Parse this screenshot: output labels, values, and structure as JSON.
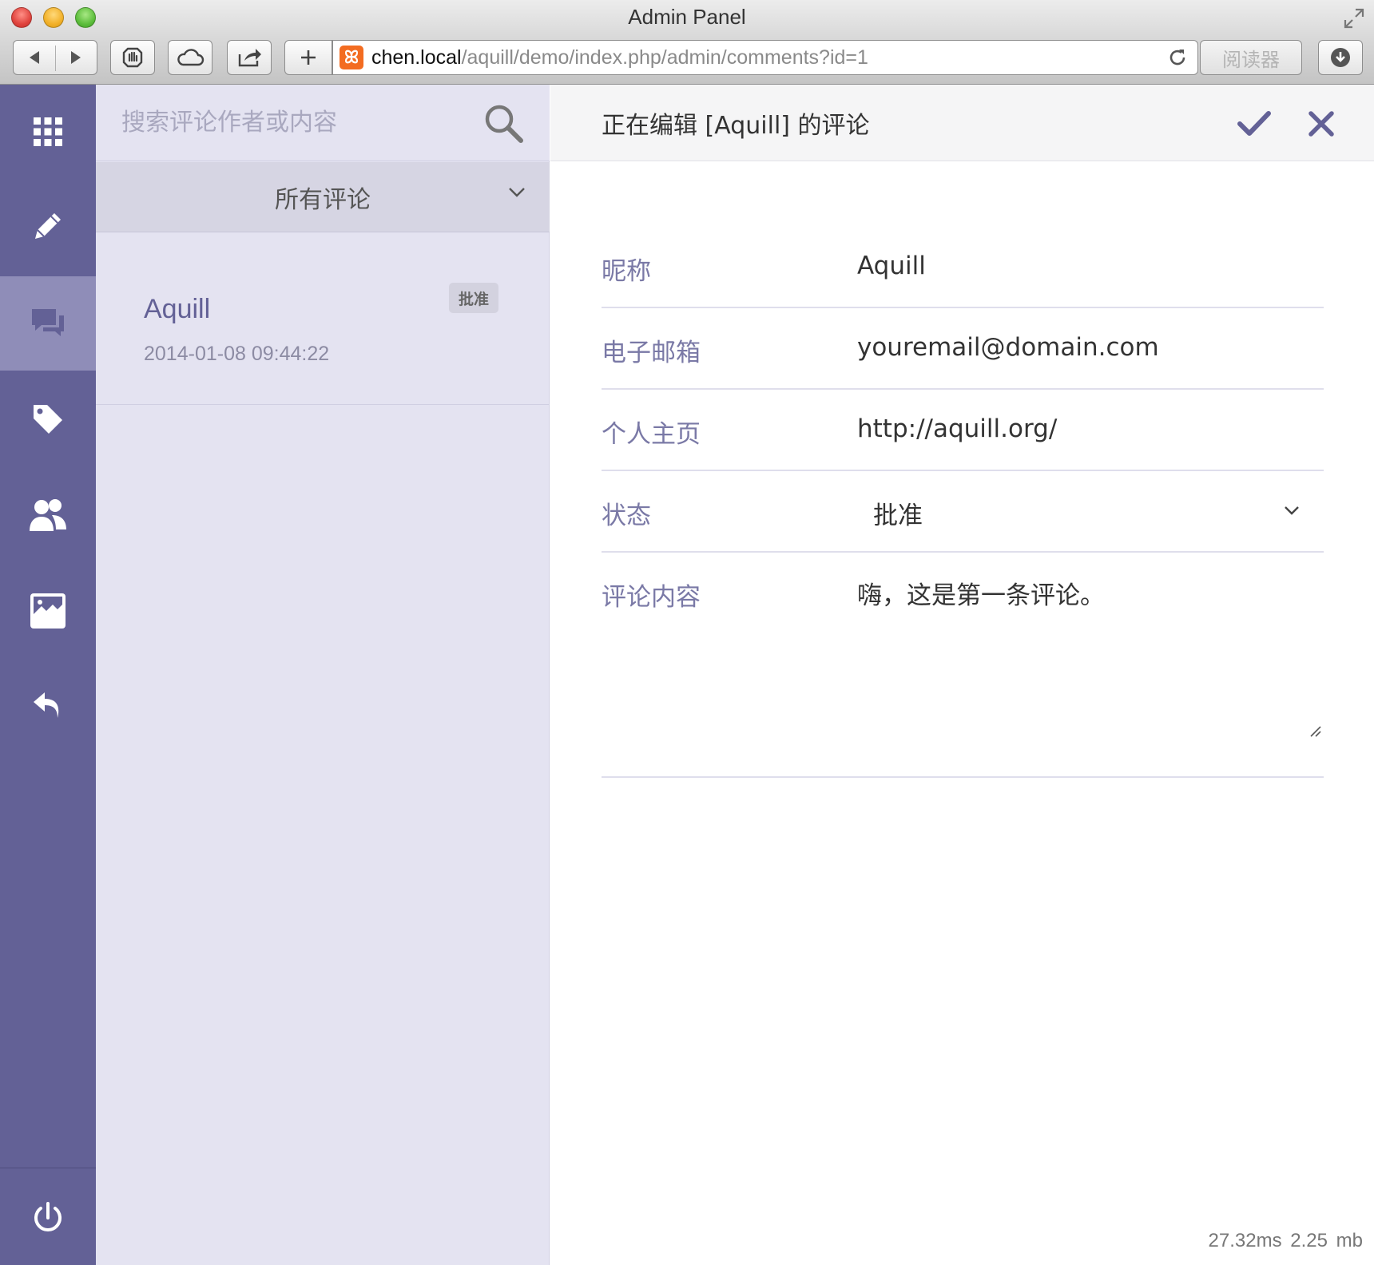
{
  "window": {
    "title": "Admin Panel"
  },
  "browser": {
    "url_host": "chen.local",
    "url_path": "/aquill/demo/index.php/admin/comments?id=1",
    "reader_label": "阅读器"
  },
  "sidebar": {
    "items": [
      {
        "icon": "grid-icon",
        "label": "dashboard"
      },
      {
        "icon": "pencil-icon",
        "label": "posts"
      },
      {
        "icon": "comments-icon",
        "label": "comments",
        "active": true
      },
      {
        "icon": "tag-icon",
        "label": "tags"
      },
      {
        "icon": "users-icon",
        "label": "users"
      },
      {
        "icon": "image-icon",
        "label": "media"
      },
      {
        "icon": "back-arrow-icon",
        "label": "back"
      }
    ],
    "footer_icon": "power-icon",
    "background": "#636196",
    "active_background": "#8f8db8"
  },
  "list": {
    "search_placeholder": "搜索评论作者或内容",
    "filter_label": "所有评论",
    "comments": [
      {
        "author": "Aquill",
        "date": "2014-01-08 09:44:22",
        "status": "批准"
      }
    ]
  },
  "editor": {
    "title": "正在编辑 [Aquill] 的评论",
    "fields": {
      "nickname": {
        "label": "昵称",
        "value": "Aquill"
      },
      "email": {
        "label": "电子邮箱",
        "value": "youremail@domain.com"
      },
      "homepage": {
        "label": "个人主页",
        "value": "http://aquill.org/"
      },
      "status": {
        "label": "状态",
        "value": "批准"
      },
      "content": {
        "label": "评论内容",
        "value": "嗨，这是第一条评论。"
      }
    }
  },
  "footer": {
    "time": "27.32ms",
    "memory": "2.25 mb"
  },
  "colors": {
    "accent": "#636196",
    "label": "#7a79a6",
    "list_background": "#e4e3f1"
  }
}
